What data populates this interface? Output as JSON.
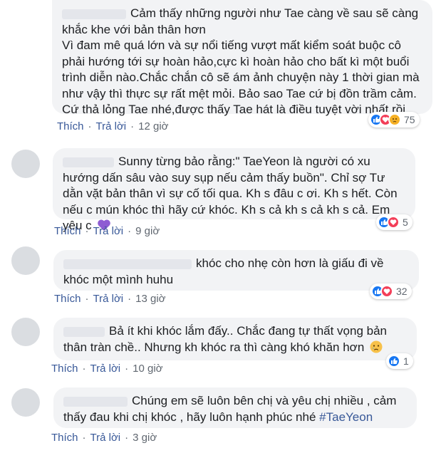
{
  "comments": [
    {
      "text": "Cảm thấy những người như Tae càng về sau sẽ càng khắc khe với bản thân hơn\nVì đam mê quá lớn và sự nổi tiếng vượt mất kiểm soát buộc cô phải hướng tới sự hoàn hảo,cực kì hoàn hảo cho bất kì một buổi trình diễn nào.Chắc chắn cô sẽ ám ảnh chuyện này 1 thời gian mà như vậy thì thực sự rất mệt mỏi. Bảo sao Tae cứ bị đồn trầm cảm. Cứ thả lỏng Tae nhé,được thấy Tae hát là điều tuyệt vời nhất rồi.",
      "like_label": "Thích",
      "reply_label": "Trả lời",
      "time": "12 giờ",
      "reaction_count": "75",
      "reactions": [
        "like",
        "love",
        "sad"
      ]
    },
    {
      "text": "Sunny từng bảo rằng:\" TaeYeon là người có xu hướng dấn sâu vào suy sụp nếu cảm thấy buồn\". Chỉ sợ Tư dằn vặt bản thân vì sự cố tối qua. Kh s đâu c ơi. Kh s hết. Còn nếu c mún khóc thì hãy cứ khóc. Kh s cả kh s cả kh s cả. Em yêu c",
      "like_label": "Thích",
      "reply_label": "Trả lời",
      "time": "9 giờ",
      "reaction_count": "5",
      "reactions": [
        "like",
        "love"
      ]
    },
    {
      "text": "khóc cho nhẹ còn hơn là giấu đi về khóc một mình huhu",
      "like_label": "Thích",
      "reply_label": "Trả lời",
      "time": "13 giờ",
      "reaction_count": "32",
      "reactions": [
        "like",
        "love"
      ]
    },
    {
      "text": "Bả ít khi khóc lắm đấy.. Chắc đang tự thất vọng bản thân tràn chề.. Nhưng kh khóc ra thì càng khó khăn hơn",
      "like_label": "Thích",
      "reply_label": "Trả lời",
      "time": "10 giờ",
      "reaction_count": "1",
      "reactions": [
        "like"
      ]
    },
    {
      "text": "Chúng em sẽ luôn bên chị và yêu chị nhiều , cảm thấy đau khi chị khóc , hãy luôn hạnh phúc nhé",
      "hashtag": "#TaeYeon",
      "like_label": "Thích",
      "reply_label": "Trả lời",
      "time": "3 giờ"
    }
  ],
  "separator": "·",
  "colors": {
    "link": "#385898",
    "bubble": "#f2f3f5",
    "like": "#1877f2",
    "love": "#f33e58",
    "sad": "#f7b125"
  }
}
